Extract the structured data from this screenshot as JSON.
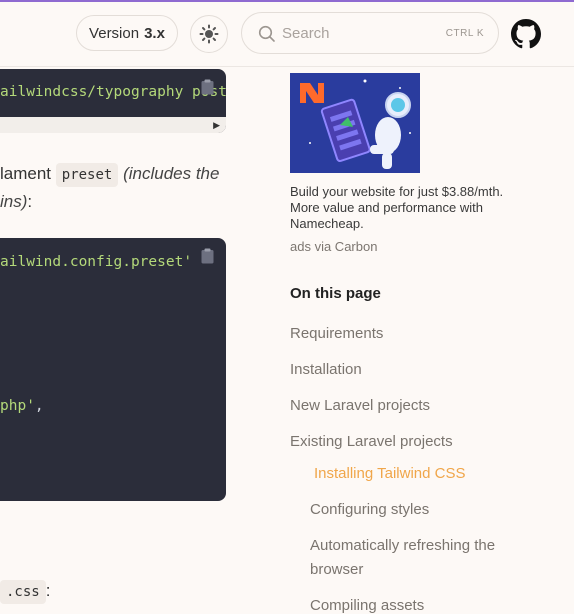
{
  "header": {
    "version_prefix": "Version",
    "version_value": "3.x",
    "search_placeholder": "Search",
    "search_shortcut": "CTRL K"
  },
  "content": {
    "code_block_1": "ailwindcss/typography postcss",
    "paragraph_start": "lament",
    "paragraph_code": "preset",
    "paragraph_italic_1": "(includes the",
    "paragraph_italic_2": "ins)",
    "paragraph_end": ":",
    "code_block_2_line_1": "ailwind.config.preset'",
    "code_block_2_line_2": "php'",
    "code_block_2_line_2_punct": ",",
    "bottom_code": ".css",
    "bottom_end": ":"
  },
  "ad": {
    "text": "Build your website for just $3.88/mth. More value and performance with Namecheap.",
    "via": "ads via Carbon"
  },
  "toc": {
    "title": "On this page",
    "items": [
      {
        "label": "Requirements"
      },
      {
        "label": "Installation"
      },
      {
        "label": "New Laravel projects"
      },
      {
        "label": "Existing Laravel projects"
      },
      {
        "label": "Installing Tailwind CSS"
      },
      {
        "label": "Configuring styles"
      },
      {
        "label": "Automatically refreshing the"
      },
      {
        "label": "browser"
      },
      {
        "label": "Compiling assets"
      }
    ]
  },
  "colors": {
    "accent": "#8f6ad1",
    "toc_active": "#f0a64a",
    "code_bg": "#2b2d3a",
    "code_string": "#b4d97a"
  }
}
